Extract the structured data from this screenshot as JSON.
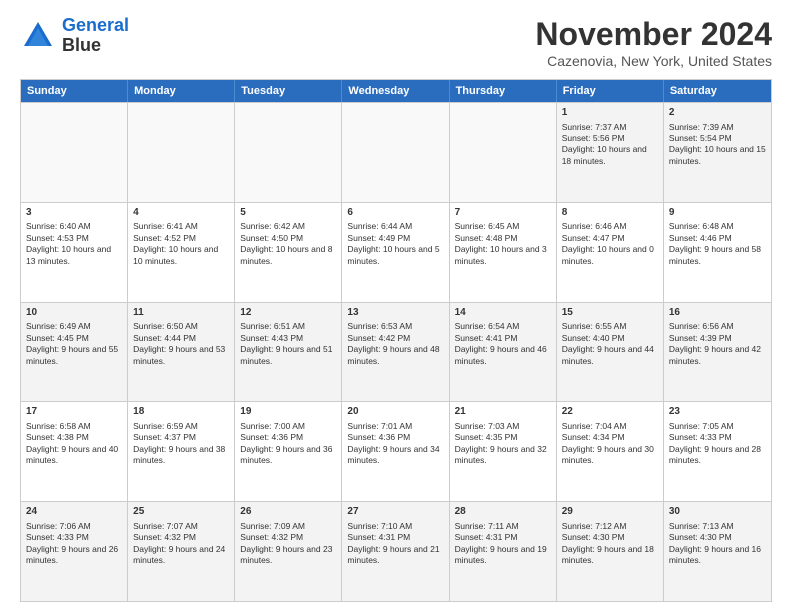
{
  "logo": {
    "line1": "General",
    "line2": "Blue"
  },
  "title": "November 2024",
  "subtitle": "Cazenovia, New York, United States",
  "days": [
    "Sunday",
    "Monday",
    "Tuesday",
    "Wednesday",
    "Thursday",
    "Friday",
    "Saturday"
  ],
  "rows": [
    [
      {
        "day": "",
        "info": ""
      },
      {
        "day": "",
        "info": ""
      },
      {
        "day": "",
        "info": ""
      },
      {
        "day": "",
        "info": ""
      },
      {
        "day": "",
        "info": ""
      },
      {
        "day": "1",
        "info": "Sunrise: 7:37 AM\nSunset: 5:56 PM\nDaylight: 10 hours and 18 minutes."
      },
      {
        "day": "2",
        "info": "Sunrise: 7:39 AM\nSunset: 5:54 PM\nDaylight: 10 hours and 15 minutes."
      }
    ],
    [
      {
        "day": "3",
        "info": "Sunrise: 6:40 AM\nSunset: 4:53 PM\nDaylight: 10 hours and 13 minutes."
      },
      {
        "day": "4",
        "info": "Sunrise: 6:41 AM\nSunset: 4:52 PM\nDaylight: 10 hours and 10 minutes."
      },
      {
        "day": "5",
        "info": "Sunrise: 6:42 AM\nSunset: 4:50 PM\nDaylight: 10 hours and 8 minutes."
      },
      {
        "day": "6",
        "info": "Sunrise: 6:44 AM\nSunset: 4:49 PM\nDaylight: 10 hours and 5 minutes."
      },
      {
        "day": "7",
        "info": "Sunrise: 6:45 AM\nSunset: 4:48 PM\nDaylight: 10 hours and 3 minutes."
      },
      {
        "day": "8",
        "info": "Sunrise: 6:46 AM\nSunset: 4:47 PM\nDaylight: 10 hours and 0 minutes."
      },
      {
        "day": "9",
        "info": "Sunrise: 6:48 AM\nSunset: 4:46 PM\nDaylight: 9 hours and 58 minutes."
      }
    ],
    [
      {
        "day": "10",
        "info": "Sunrise: 6:49 AM\nSunset: 4:45 PM\nDaylight: 9 hours and 55 minutes."
      },
      {
        "day": "11",
        "info": "Sunrise: 6:50 AM\nSunset: 4:44 PM\nDaylight: 9 hours and 53 minutes."
      },
      {
        "day": "12",
        "info": "Sunrise: 6:51 AM\nSunset: 4:43 PM\nDaylight: 9 hours and 51 minutes."
      },
      {
        "day": "13",
        "info": "Sunrise: 6:53 AM\nSunset: 4:42 PM\nDaylight: 9 hours and 48 minutes."
      },
      {
        "day": "14",
        "info": "Sunrise: 6:54 AM\nSunset: 4:41 PM\nDaylight: 9 hours and 46 minutes."
      },
      {
        "day": "15",
        "info": "Sunrise: 6:55 AM\nSunset: 4:40 PM\nDaylight: 9 hours and 44 minutes."
      },
      {
        "day": "16",
        "info": "Sunrise: 6:56 AM\nSunset: 4:39 PM\nDaylight: 9 hours and 42 minutes."
      }
    ],
    [
      {
        "day": "17",
        "info": "Sunrise: 6:58 AM\nSunset: 4:38 PM\nDaylight: 9 hours and 40 minutes."
      },
      {
        "day": "18",
        "info": "Sunrise: 6:59 AM\nSunset: 4:37 PM\nDaylight: 9 hours and 38 minutes."
      },
      {
        "day": "19",
        "info": "Sunrise: 7:00 AM\nSunset: 4:36 PM\nDaylight: 9 hours and 36 minutes."
      },
      {
        "day": "20",
        "info": "Sunrise: 7:01 AM\nSunset: 4:36 PM\nDaylight: 9 hours and 34 minutes."
      },
      {
        "day": "21",
        "info": "Sunrise: 7:03 AM\nSunset: 4:35 PM\nDaylight: 9 hours and 32 minutes."
      },
      {
        "day": "22",
        "info": "Sunrise: 7:04 AM\nSunset: 4:34 PM\nDaylight: 9 hours and 30 minutes."
      },
      {
        "day": "23",
        "info": "Sunrise: 7:05 AM\nSunset: 4:33 PM\nDaylight: 9 hours and 28 minutes."
      }
    ],
    [
      {
        "day": "24",
        "info": "Sunrise: 7:06 AM\nSunset: 4:33 PM\nDaylight: 9 hours and 26 minutes."
      },
      {
        "day": "25",
        "info": "Sunrise: 7:07 AM\nSunset: 4:32 PM\nDaylight: 9 hours and 24 minutes."
      },
      {
        "day": "26",
        "info": "Sunrise: 7:09 AM\nSunset: 4:32 PM\nDaylight: 9 hours and 23 minutes."
      },
      {
        "day": "27",
        "info": "Sunrise: 7:10 AM\nSunset: 4:31 PM\nDaylight: 9 hours and 21 minutes."
      },
      {
        "day": "28",
        "info": "Sunrise: 7:11 AM\nSunset: 4:31 PM\nDaylight: 9 hours and 19 minutes."
      },
      {
        "day": "29",
        "info": "Sunrise: 7:12 AM\nSunset: 4:30 PM\nDaylight: 9 hours and 18 minutes."
      },
      {
        "day": "30",
        "info": "Sunrise: 7:13 AM\nSunset: 4:30 PM\nDaylight: 9 hours and 16 minutes."
      }
    ]
  ]
}
